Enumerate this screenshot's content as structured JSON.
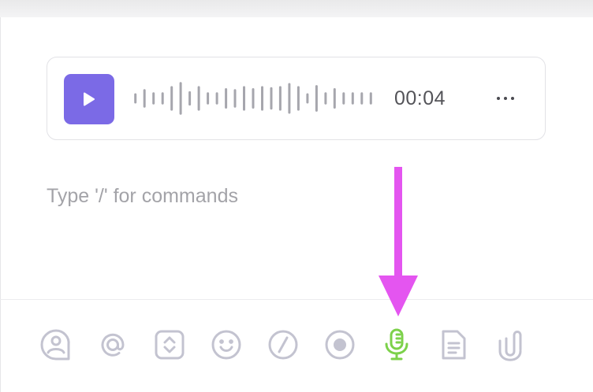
{
  "audio_message": {
    "duration": "00:04",
    "waveform_levels": [
      0.25,
      0.45,
      0.3,
      0.3,
      0.6,
      0.8,
      0.35,
      0.6,
      0.3,
      0.3,
      0.5,
      0.45,
      0.6,
      0.5,
      0.6,
      0.55,
      0.6,
      0.75,
      0.6,
      0.25,
      0.65,
      0.3,
      0.5,
      0.3,
      0.3,
      0.3,
      0.3
    ]
  },
  "editor": {
    "placeholder": "Type '/' for commands"
  },
  "toolbar": {
    "items": [
      {
        "icon": "assign-user-icon"
      },
      {
        "icon": "mention-icon"
      },
      {
        "icon": "expand-icon"
      },
      {
        "icon": "emoji-icon"
      },
      {
        "icon": "slash-command-icon"
      },
      {
        "icon": "record-icon"
      },
      {
        "icon": "microphone-icon",
        "active": true
      },
      {
        "icon": "document-icon"
      },
      {
        "icon": "attachment-icon"
      }
    ]
  },
  "colors": {
    "play_button": "#7b6ae6",
    "waveform": "#a6a6ad",
    "toolbar_icon": "#c3c3d0",
    "mic_active": "#7cd14a",
    "annotation_arrow": "#e455f0",
    "placeholder": "#a3a3a8"
  }
}
